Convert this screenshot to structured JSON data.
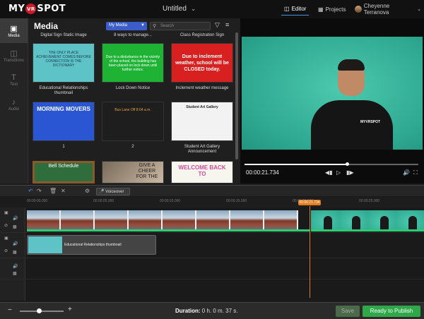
{
  "app": {
    "logo_left": "MY",
    "logo_mid": "VR",
    "logo_right": "SPOT",
    "title": "Untitled",
    "editor_label": "Editor",
    "projects_label": "Projects",
    "user_name": "Cheyenne Terranova"
  },
  "rail": {
    "media": "Media",
    "transitions": "Transitions",
    "text": "Text",
    "audio": "Audio"
  },
  "media": {
    "heading": "Media",
    "filter_value": "My Media",
    "search_placeholder": "Search",
    "top_titles": [
      "Digital Sign Static Image",
      "8 ways to manage...",
      "Class Registration Sign"
    ],
    "row1": [
      {
        "title": "Educational Relationships thumbnail",
        "mini": "THE ONLY PLACE ACHIEVEMENT COMES BEFORE CONNECTION IS THE DICTIONARY"
      },
      {
        "title": "Lock Down Notice",
        "mini": "Due to a disturbance in the vicinity of the school, the building has been placed on lock down until further notice."
      },
      {
        "title": "Inclement weather message",
        "mini": "Due to inclement weather, school will be CLOSED today."
      }
    ],
    "row2": [
      {
        "title": "1",
        "mini": "MORNING MOVERS"
      },
      {
        "title": "2",
        "mini": "Bus Lane Off   8:04 a.m."
      },
      {
        "title": "Student Art Gallery Announcement",
        "mini": "Student Art Gallery"
      }
    ],
    "row3": [
      {
        "mini": "Bell Schedule"
      },
      {
        "mini": "GIVE A CHEER FOR THE"
      },
      {
        "mini": "WELCOME BACK TO"
      }
    ]
  },
  "preview": {
    "time": "00:00:21.734",
    "shirt_logo": "MYVRSPOT",
    "progress_fraction": 0.58
  },
  "timeline": {
    "voiceover_label": "Voiceover",
    "ticks": [
      "00:00:00.000",
      "00:00:05.000",
      "00:00:10.000",
      "00:00:15.000",
      "00:00:20.000",
      "00:00:25.000"
    ],
    "playhead_label": "00:00:21.734",
    "image_clip_label": "Educational Relationships thumbnail"
  },
  "bottom": {
    "duration_label": "Duration:",
    "duration_value": "0 h. 0 m. 37 s.",
    "save_label": "Save",
    "publish_label": "Ready to Publish"
  }
}
